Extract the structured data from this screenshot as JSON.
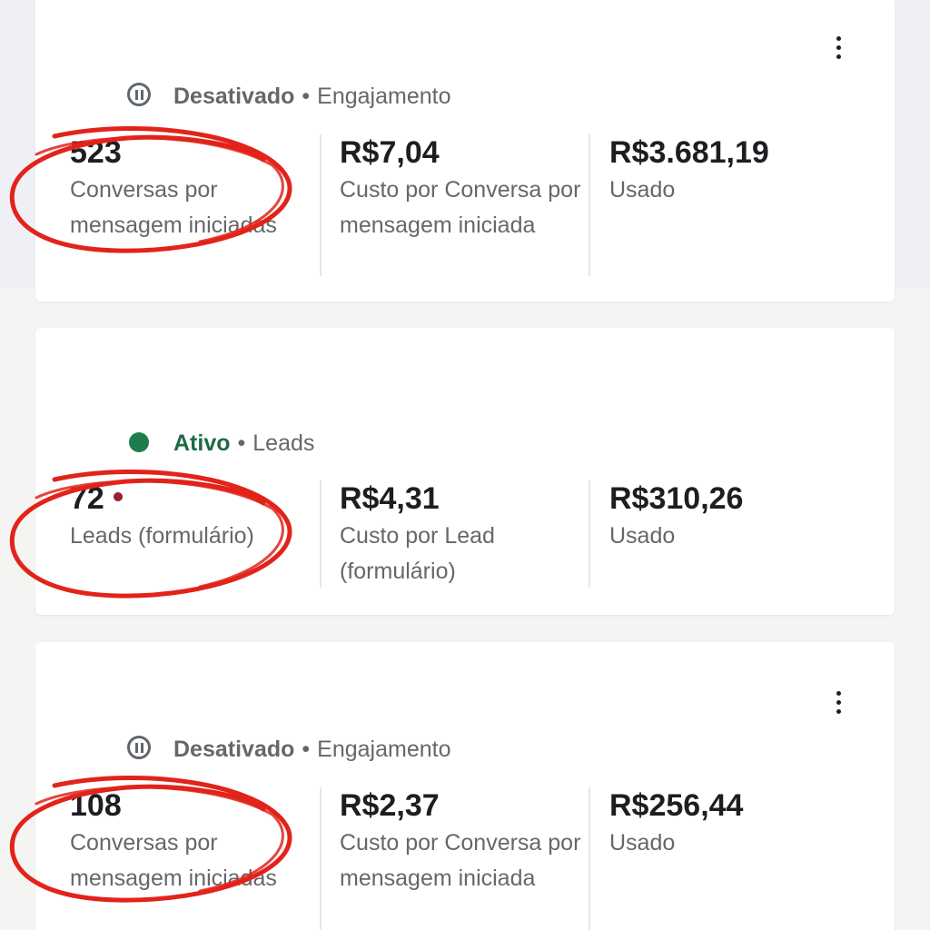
{
  "colors": {
    "accent_red": "#e2231a",
    "active_green": "#1e7d4a",
    "value_text": "#1c1e21",
    "label_text": "#65676b"
  },
  "campaigns": [
    {
      "thumbnail": "campaign-thumbnail",
      "status_icon": "pause-icon",
      "status": "Desativado",
      "separator": "•",
      "objective": "Engajamento",
      "metrics": [
        {
          "value": "523",
          "label": "Conversas por mensagem iniciadas"
        },
        {
          "value": "R$7,04",
          "label": "Custo por Conversa por mensagem iniciada"
        },
        {
          "value": "R$3.681,19",
          "label": "Usado"
        }
      ]
    },
    {
      "thumbnail": "campaign-thumbnail",
      "status_icon": "active-dot-icon",
      "status": "Ativo",
      "separator": "•",
      "objective": "Leads",
      "metrics": [
        {
          "value": "72",
          "label": "Leads (formulário)"
        },
        {
          "value": "R$4,31",
          "label": "Custo por Lead (formulário)"
        },
        {
          "value": "R$310,26",
          "label": "Usado"
        }
      ]
    },
    {
      "thumbnail": "campaign-thumbnail",
      "status_icon": "pause-icon",
      "status": "Desativado",
      "separator": "•",
      "objective": "Engajamento",
      "metrics": [
        {
          "value": "108",
          "label": "Conversas por mensagem iniciadas"
        },
        {
          "value": "R$2,37",
          "label": "Custo por Conversa por mensagem iniciada"
        },
        {
          "value": "R$256,44",
          "label": "Usado"
        }
      ]
    }
  ]
}
